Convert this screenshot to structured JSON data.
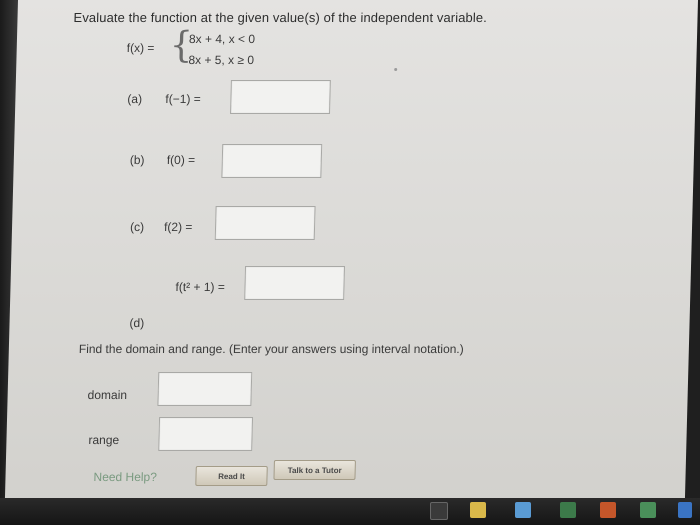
{
  "question": {
    "title": "Evaluate the function at the given value(s) of the independent variable.",
    "function_name": "f(x) =",
    "cases": [
      "8x + 4, x < 0",
      "8x + 5, x ≥ 0"
    ]
  },
  "parts": {
    "a": {
      "label": "(a)",
      "expr": "f(−1) =",
      "value": ""
    },
    "b": {
      "label": "(b)",
      "expr": "f(0) =",
      "value": ""
    },
    "c": {
      "label": "(c)",
      "expr": "f(2) =",
      "value": ""
    },
    "d": {
      "label": "(d)",
      "expr": "f(t² + 1) =",
      "value": ""
    }
  },
  "domain_range": {
    "instruction": "Find the domain and range. (Enter your answers using interval notation.)",
    "domain_label": "domain",
    "domain_value": "",
    "range_label": "range",
    "range_value": ""
  },
  "help": {
    "need_help": "Need Help?",
    "read_it": "Read It",
    "talk_to_tutor": "Talk to a Tutor"
  },
  "colors": {
    "background": "#dcdbd8",
    "need_help": "#7a9a80"
  }
}
